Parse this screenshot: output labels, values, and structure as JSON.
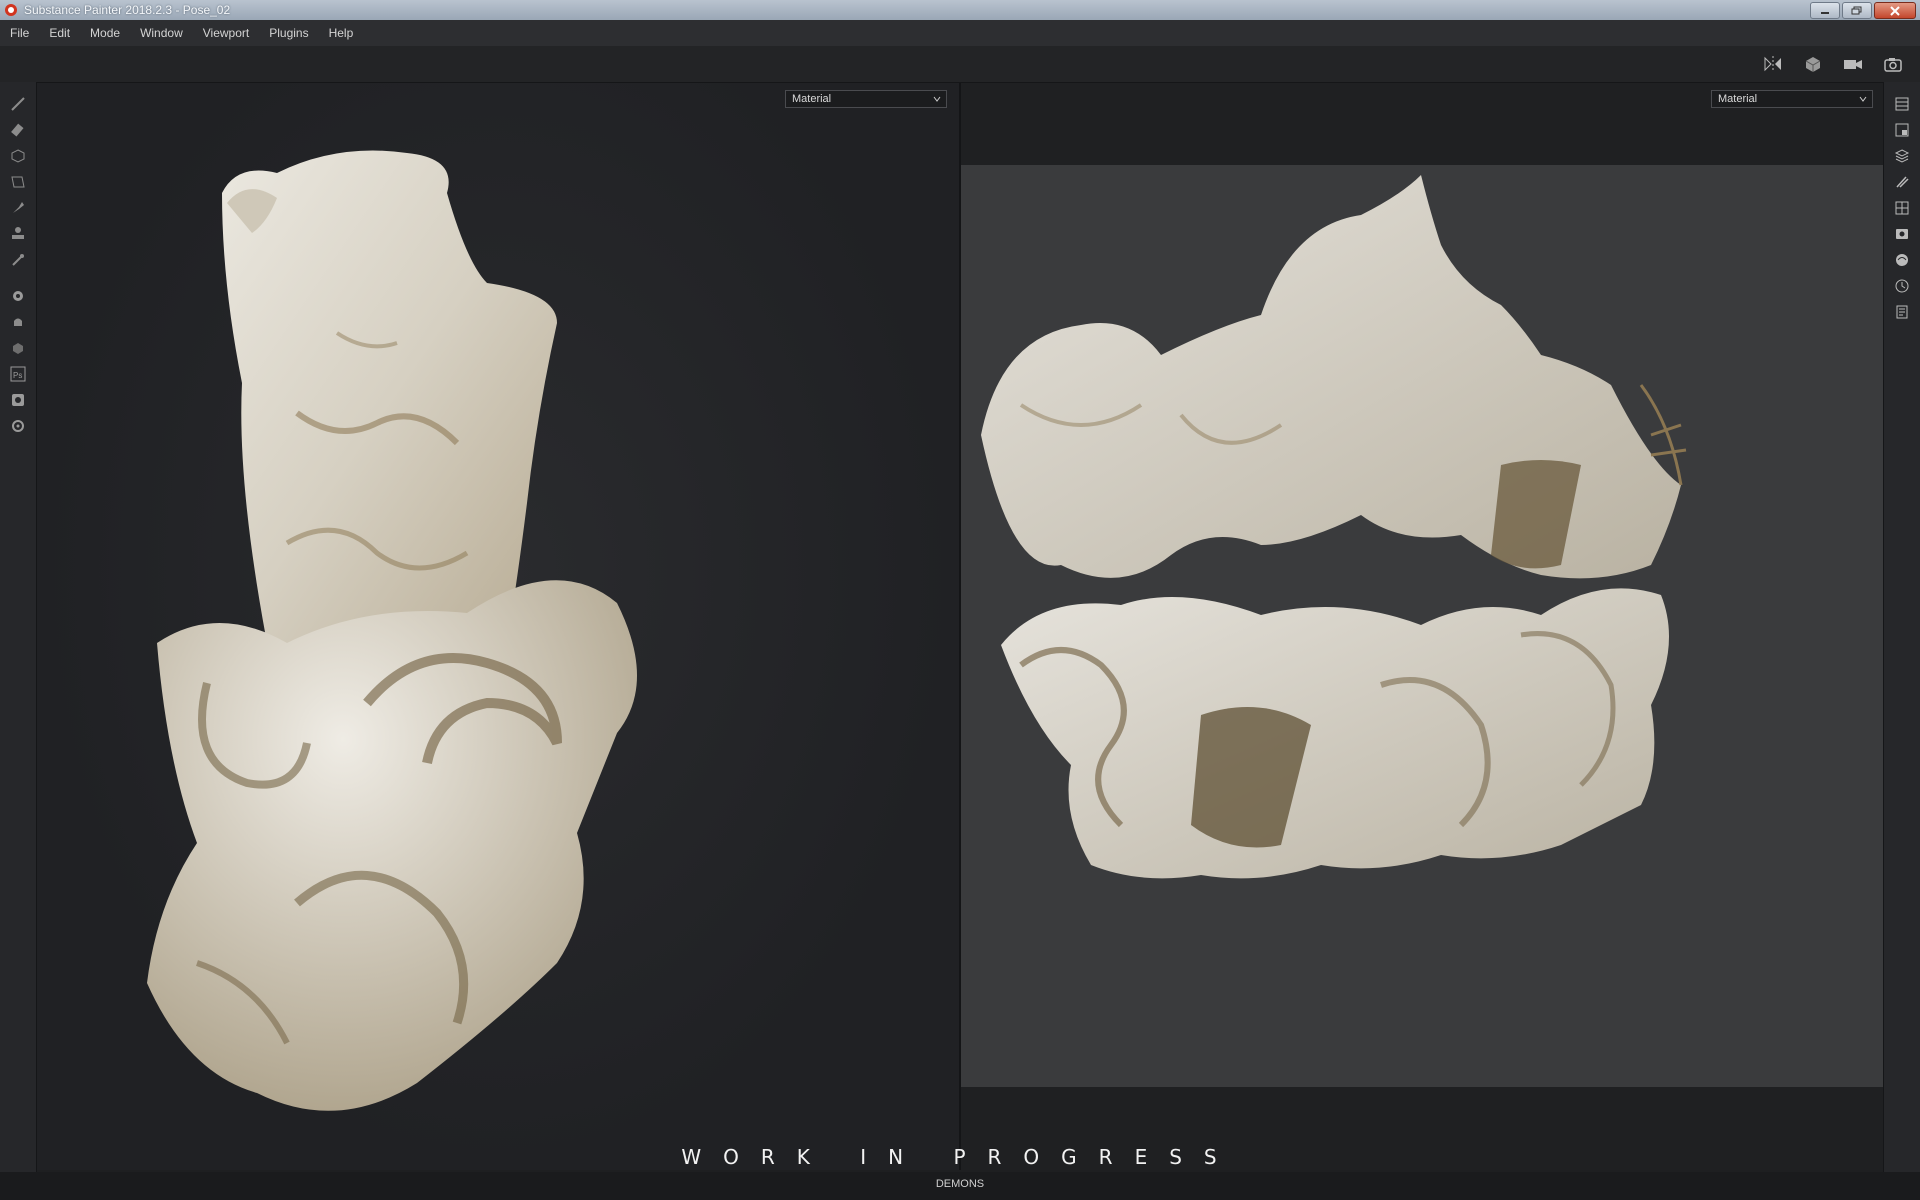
{
  "window": {
    "title": "Substance Painter 2018.2.3 - Pose_02",
    "buttons": [
      "minimize",
      "restore",
      "close"
    ]
  },
  "menu": [
    "File",
    "Edit",
    "Mode",
    "Window",
    "Viewport",
    "Plugins",
    "Help"
  ],
  "top_tools": [
    "symmetry-icon",
    "display-cube-icon",
    "camera-video-icon",
    "screenshot-camera-icon"
  ],
  "left_tools": [
    "paint-brush-icon",
    "eraser-icon",
    "projection-icon",
    "polygon-fill-icon",
    "smudge-icon",
    "clone-stamp-icon",
    "color-picker-icon",
    "bake-icon",
    "iray-icon",
    "settings-3d-icon",
    "photoshop-icon",
    "export-icon",
    "gear-icon"
  ],
  "right_tools": [
    "layers-list-icon",
    "texture-set-icon",
    "layer-stack-icon",
    "brush-settings-icon",
    "uv-grid-icon",
    "display-settings-icon",
    "environment-icon",
    "history-icon",
    "log-icon"
  ],
  "viewport_3d": {
    "channel_select": "Material"
  },
  "viewport_2d": {
    "channel_select": "Material"
  },
  "overlay_text": "WORK IN PROGRESS",
  "status": "DEMONS",
  "colors": {
    "marble": "#ddd8cc",
    "vein": "#8a7550",
    "background": "#1e1f21",
    "uv_bg": "#3a3b3d"
  }
}
